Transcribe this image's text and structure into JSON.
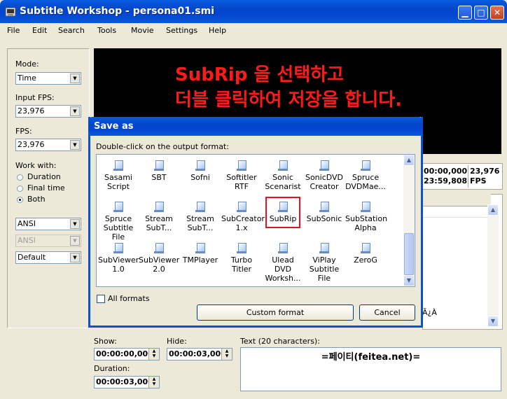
{
  "window": {
    "title": "Subtitle Workshop - persona01.smi"
  },
  "menu": [
    "File",
    "Edit",
    "Search",
    "Tools",
    "Movie",
    "Settings",
    "Help"
  ],
  "left_panel": {
    "mode_label": "Mode:",
    "mode_value": "Time",
    "input_fps_label": "Input FPS:",
    "input_fps_value": "23,976",
    "fps_label": "FPS:",
    "fps_value": "23,976",
    "work_with_label": "Work with:",
    "radios": [
      {
        "label": "Duration",
        "checked": false
      },
      {
        "label": "Final time",
        "checked": false
      },
      {
        "label": "Both",
        "checked": true
      }
    ],
    "charset1": "ANSI",
    "charset2": "ANSI",
    "style": "Default"
  },
  "overlay_text": {
    "line1": "SubRip 을 선택하고",
    "line2": "더블 클릭하여 저장을 합니다."
  },
  "timing": {
    "time1": "00:00,000",
    "time2": "23:59,808",
    "fps_value": "23,976",
    "fps_label": "FPS"
  },
  "grid_text": "Ã¿À",
  "dialog": {
    "title": "Save as",
    "instruction": "Double-click on the output format:",
    "formats": [
      [
        "Sasami Script",
        "SBT",
        "Sofni",
        "Softitler RTF",
        "Sonic Scenarist",
        "SonicDVD Creator",
        "Spruce DVDMae..."
      ],
      [
        "Spruce Subtitle File",
        "Stream SubT...",
        "Stream SubT...",
        "SubCreator 1.x",
        "SubRip",
        "SubSonic",
        "SubStation Alpha"
      ],
      [
        "SubViewer 1.0",
        "SubViewer 2.0",
        "TMPlayer",
        "Turbo Titler",
        "Ulead DVD Worksh...",
        "ViPlay Subtitle File",
        "ZeroG"
      ]
    ],
    "highlighted": "SubRip",
    "all_formats_label": "All formats",
    "all_formats_checked": false,
    "custom_format_button": "Custom format",
    "cancel_button": "Cancel"
  },
  "bottom": {
    "show_label": "Show:",
    "show_value": "00:00:00,000",
    "hide_label": "Hide:",
    "hide_value": "00:00:03,000",
    "duration_label": "Duration:",
    "duration_value": "00:00:03,000",
    "text_label": "Text (20 characters):",
    "text_value": "=페이티(feitea.net)="
  },
  "colors": {
    "accent": "#0a4fd4",
    "overlay_text": "#ff1a1a",
    "highlight_box": "#e0141e"
  }
}
